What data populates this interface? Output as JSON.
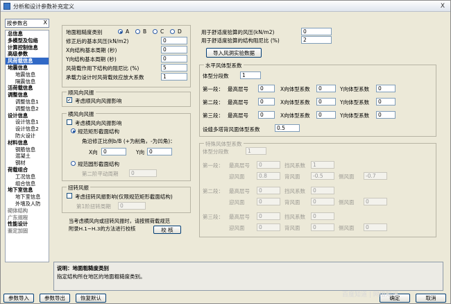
{
  "window": {
    "title": "分析和设计参数补充定义",
    "close": "X"
  },
  "nav": {
    "search_value": "按参数名",
    "clear": "X",
    "items": [
      {
        "label": "总信息",
        "level": 1
      },
      {
        "label": "多模型及包络",
        "level": 1
      },
      {
        "label": "计算控制信息",
        "level": 1
      },
      {
        "label": "高级参数",
        "level": 1
      },
      {
        "label": "风荷载信息",
        "level": 1,
        "selected": true
      },
      {
        "label": "地震信息",
        "level": 1
      },
      {
        "label": "地震信息",
        "level": 2
      },
      {
        "label": "隔震信息",
        "level": 2
      },
      {
        "label": "活荷载信息",
        "level": 1
      },
      {
        "label": "调整信息",
        "level": 1
      },
      {
        "label": "调整信息1",
        "level": 2
      },
      {
        "label": "调整信息2",
        "level": 2
      },
      {
        "label": "设计信息",
        "level": 1
      },
      {
        "label": "设计信息1",
        "level": 2
      },
      {
        "label": "设计信息2",
        "level": 2
      },
      {
        "label": "防火设计",
        "level": 2
      },
      {
        "label": "材料信息",
        "level": 1
      },
      {
        "label": "钢筋信息",
        "level": 2
      },
      {
        "label": "混凝土",
        "level": 2
      },
      {
        "label": "钢材",
        "level": 2
      },
      {
        "label": "荷载组合",
        "level": 1
      },
      {
        "label": "工况信息",
        "level": 2
      },
      {
        "label": "组合信息",
        "level": 2
      },
      {
        "label": "地下室信息",
        "level": 1
      },
      {
        "label": "地下室信息",
        "level": 2
      },
      {
        "label": "外墙及人防",
        "level": 2
      },
      {
        "label": "砌体结构",
        "level": 1,
        "disabled": true
      },
      {
        "label": "广东规程",
        "level": 1,
        "disabled": true
      },
      {
        "label": "性能设计",
        "level": 1
      },
      {
        "label": "鉴定加固",
        "level": 1,
        "disabled": true
      }
    ]
  },
  "wind": {
    "terrain_label": "地面粗糙度类别",
    "terrain_options": [
      "A",
      "B",
      "C",
      "D"
    ],
    "terrain_selected": "A",
    "rows": [
      {
        "label": "修正后的基本风压(kN/m2)",
        "value": "0"
      },
      {
        "label": "X向结构基本周期 (秒)",
        "value": "0"
      },
      {
        "label": "Y向结构基本周期 (秒)",
        "value": "0"
      },
      {
        "label": "风荷载作用下结构的阻尼比 (%)",
        "value": "5"
      },
      {
        "label": "承载力设计时风荷载效应放大系数",
        "value": "1"
      }
    ],
    "along": {
      "title": "顺风向风振",
      "check": "考虑顺风向风振影响",
      "checked": true
    },
    "cross": {
      "title": "横风向风振",
      "check": "考虑横风向风振影响",
      "rect_label": "规范矩形截面结构",
      "corner_label": "角沿修正比例b/B (+为削角，-为凹角)：",
      "x_label": "X向",
      "x_value": "0",
      "y_label": "Y向",
      "y_value": "0",
      "round_label": "规范圆形截面结构",
      "period2_label": "第二阶平动周期",
      "period2_value": "0"
    },
    "torsion": {
      "title": "扭转风振",
      "check": "考虑扭转风振影响(仅限规范矩形截面结构)",
      "period1_label": "第1阶扭转周期",
      "period1_value": "0"
    },
    "note": "当考虑横风向或扭转风振时，请按照荷载规范附录H.1~H.3的方法进行校核",
    "check_button": "校 核"
  },
  "comfort": {
    "pressure_label": "用于舒适度验算的风压(kN/m2)",
    "pressure_value": "0",
    "damping_label": "用于舒适度验算的结构阻尼比 (%)",
    "damping_value": "2",
    "import_button": "导入风洞实验数据"
  },
  "horizontal": {
    "title": "水平风体型系数",
    "segments_label": "体型分段数",
    "segments_value": "1",
    "rows": [
      {
        "label": "第一段：",
        "top": "0",
        "x": "0",
        "y": "0"
      },
      {
        "label": "第二段：",
        "top": "0",
        "x": "0",
        "y": "0"
      },
      {
        "label": "第三段：",
        "top": "0",
        "x": "0",
        "y": "0"
      }
    ],
    "top_label": "最高层号",
    "x_label": "X向体型系数",
    "y_label": "Y向体型系数",
    "multi_label": "设缝多塔背风面体型系数",
    "multi_value": "0.5"
  },
  "special": {
    "title": "特殊风体型系数",
    "segments_label": "体型分段数",
    "segments_value": "1",
    "top_label": "最高层号",
    "coef_label": "挡风系数",
    "windward_label": "迎风面",
    "leeward_label": "背风面",
    "side_label": "侧风面",
    "rows": [
      {
        "label": "第一段：",
        "top": "0",
        "coef": "1",
        "windward": "0.8",
        "leeward": "-0.5",
        "side": "-0.7"
      },
      {
        "label": "第二段：",
        "top": "0",
        "coef": "0",
        "windward": "0",
        "leeward": "0",
        "side": "0"
      },
      {
        "label": "第三段：",
        "top": "0",
        "coef": "0",
        "windward": "0",
        "leeward": "0",
        "side": "0"
      }
    ]
  },
  "description": {
    "title": "说明：地面粗糙度类别",
    "body": "指定结构所在地区的地面粗糙度类别。"
  },
  "footer": {
    "import_button": "参数导入",
    "export_button": "参数导出",
    "default_button": "恢复默认",
    "ok_button": "确定",
    "cancel_button": "取消"
  },
  "watermark": "百度知道 | 网络知识"
}
